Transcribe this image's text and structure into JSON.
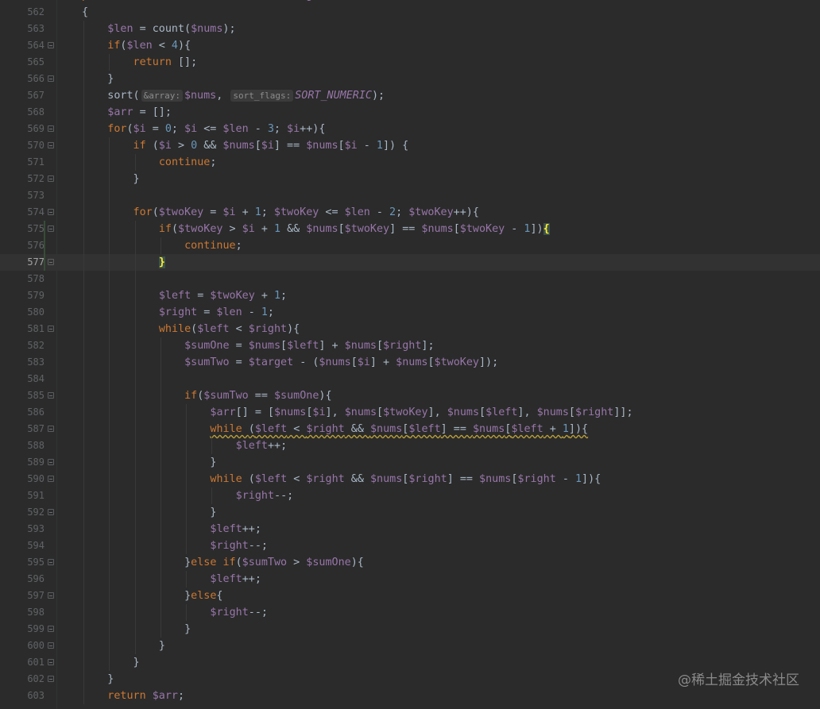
{
  "editor": {
    "lines": [
      {
        "n": "561",
        "indent": 1,
        "tokens": [
          [
            "kw",
            "public "
          ],
          [
            "kw",
            "function "
          ],
          [
            "p",
            "fourSum("
          ],
          [
            "var",
            "$nums"
          ],
          [
            "p",
            ", "
          ],
          [
            "var",
            "$target"
          ],
          [
            "p",
            ")"
          ]
        ]
      },
      {
        "n": "562",
        "indent": 1,
        "tokens": [
          [
            "p",
            "{"
          ]
        ]
      },
      {
        "n": "563",
        "indent": 2,
        "tokens": [
          [
            "var",
            "$len"
          ],
          [
            "p",
            " = count("
          ],
          [
            "var",
            "$nums"
          ],
          [
            "p",
            ");"
          ]
        ]
      },
      {
        "n": "564",
        "indent": 2,
        "fold": true,
        "tokens": [
          [
            "kw",
            "if"
          ],
          [
            "p",
            "("
          ],
          [
            "var",
            "$len"
          ],
          [
            "p",
            " < "
          ],
          [
            "num",
            "4"
          ],
          [
            "p",
            "){"
          ]
        ]
      },
      {
        "n": "565",
        "indent": 3,
        "tokens": [
          [
            "kw",
            "return "
          ],
          [
            "p",
            "[];"
          ]
        ]
      },
      {
        "n": "566",
        "indent": 2,
        "fold": true,
        "tokens": [
          [
            "p",
            "}"
          ]
        ]
      },
      {
        "n": "567",
        "indent": 2,
        "tokens": [
          [
            "p",
            "sort("
          ],
          [
            "hint",
            "&array:"
          ],
          [
            "var",
            "$nums"
          ],
          [
            "p",
            ", "
          ],
          [
            "hint",
            "sort_flags:"
          ],
          [
            "const",
            "SORT_NUMERIC"
          ],
          [
            "p",
            ");"
          ]
        ]
      },
      {
        "n": "568",
        "indent": 2,
        "tokens": [
          [
            "var",
            "$arr"
          ],
          [
            "p",
            " = [];"
          ]
        ]
      },
      {
        "n": "569",
        "indent": 2,
        "fold": true,
        "tokens": [
          [
            "kw",
            "for"
          ],
          [
            "p",
            "("
          ],
          [
            "var",
            "$i"
          ],
          [
            "p",
            " = "
          ],
          [
            "num",
            "0"
          ],
          [
            "p",
            "; "
          ],
          [
            "var",
            "$i"
          ],
          [
            "p",
            " <= "
          ],
          [
            "var",
            "$len"
          ],
          [
            "p",
            " - "
          ],
          [
            "num",
            "3"
          ],
          [
            "p",
            "; "
          ],
          [
            "var",
            "$i"
          ],
          [
            "p",
            "++){"
          ]
        ]
      },
      {
        "n": "570",
        "indent": 3,
        "fold": true,
        "tokens": [
          [
            "kw",
            "if "
          ],
          [
            "p",
            "("
          ],
          [
            "var",
            "$i"
          ],
          [
            "p",
            " > "
          ],
          [
            "num",
            "0"
          ],
          [
            "p",
            " && "
          ],
          [
            "var",
            "$nums"
          ],
          [
            "p",
            "["
          ],
          [
            "var",
            "$i"
          ],
          [
            "p",
            "] == "
          ],
          [
            "var",
            "$nums"
          ],
          [
            "p",
            "["
          ],
          [
            "var",
            "$i"
          ],
          [
            "p",
            " - "
          ],
          [
            "num",
            "1"
          ],
          [
            "p",
            "]) {"
          ]
        ]
      },
      {
        "n": "571",
        "indent": 4,
        "tokens": [
          [
            "kw",
            "continue"
          ],
          [
            "p",
            ";"
          ]
        ]
      },
      {
        "n": "572",
        "indent": 3,
        "fold": true,
        "tokens": [
          [
            "p",
            "}"
          ]
        ]
      },
      {
        "n": "573",
        "indent": 3,
        "tokens": []
      },
      {
        "n": "574",
        "indent": 3,
        "fold": true,
        "tokens": [
          [
            "kw",
            "for"
          ],
          [
            "p",
            "("
          ],
          [
            "var",
            "$twoKey"
          ],
          [
            "p",
            " = "
          ],
          [
            "var",
            "$i"
          ],
          [
            "p",
            " + "
          ],
          [
            "num",
            "1"
          ],
          [
            "p",
            "; "
          ],
          [
            "var",
            "$twoKey"
          ],
          [
            "p",
            " <= "
          ],
          [
            "var",
            "$len"
          ],
          [
            "p",
            " - "
          ],
          [
            "num",
            "2"
          ],
          [
            "p",
            "; "
          ],
          [
            "var",
            "$twoKey"
          ],
          [
            "p",
            "++){"
          ]
        ]
      },
      {
        "n": "575",
        "indent": 4,
        "fold": true,
        "tokens": [
          [
            "kw",
            "if"
          ],
          [
            "p",
            "("
          ],
          [
            "var",
            "$twoKey"
          ],
          [
            "p",
            " > "
          ],
          [
            "var",
            "$i"
          ],
          [
            "p",
            " + "
          ],
          [
            "num",
            "1"
          ],
          [
            "p",
            " && "
          ],
          [
            "var",
            "$nums"
          ],
          [
            "p",
            "["
          ],
          [
            "var",
            "$twoKey"
          ],
          [
            "p",
            "] == "
          ],
          [
            "var",
            "$nums"
          ],
          [
            "p",
            "["
          ],
          [
            "var",
            "$twoKey"
          ],
          [
            "p",
            " - "
          ],
          [
            "num",
            "1"
          ],
          [
            "p",
            "])"
          ],
          [
            "hl",
            "{"
          ]
        ]
      },
      {
        "n": "576",
        "indent": 5,
        "tokens": [
          [
            "kw",
            "continue"
          ],
          [
            "p",
            ";"
          ]
        ]
      },
      {
        "n": "577",
        "indent": 4,
        "fold": true,
        "current": true,
        "tokens": [
          [
            "hl",
            "}"
          ]
        ]
      },
      {
        "n": "578",
        "indent": 4,
        "tokens": []
      },
      {
        "n": "579",
        "indent": 4,
        "tokens": [
          [
            "var",
            "$left"
          ],
          [
            "p",
            " = "
          ],
          [
            "var",
            "$twoKey"
          ],
          [
            "p",
            " + "
          ],
          [
            "num",
            "1"
          ],
          [
            "p",
            ";"
          ]
        ]
      },
      {
        "n": "580",
        "indent": 4,
        "tokens": [
          [
            "var",
            "$right"
          ],
          [
            "p",
            " = "
          ],
          [
            "var",
            "$len"
          ],
          [
            "p",
            " - "
          ],
          [
            "num",
            "1"
          ],
          [
            "p",
            ";"
          ]
        ]
      },
      {
        "n": "581",
        "indent": 4,
        "fold": true,
        "tokens": [
          [
            "kw",
            "while"
          ],
          [
            "p",
            "("
          ],
          [
            "var",
            "$left"
          ],
          [
            "p",
            " < "
          ],
          [
            "var",
            "$right"
          ],
          [
            "p",
            "){"
          ]
        ]
      },
      {
        "n": "582",
        "indent": 5,
        "tokens": [
          [
            "var",
            "$sumOne"
          ],
          [
            "p",
            " = "
          ],
          [
            "var",
            "$nums"
          ],
          [
            "p",
            "["
          ],
          [
            "var",
            "$left"
          ],
          [
            "p",
            "] + "
          ],
          [
            "var",
            "$nums"
          ],
          [
            "p",
            "["
          ],
          [
            "var",
            "$right"
          ],
          [
            "p",
            "];"
          ]
        ]
      },
      {
        "n": "583",
        "indent": 5,
        "tokens": [
          [
            "var",
            "$sumTwo"
          ],
          [
            "p",
            " = "
          ],
          [
            "var",
            "$target"
          ],
          [
            "p",
            " - ("
          ],
          [
            "var",
            "$nums"
          ],
          [
            "p",
            "["
          ],
          [
            "var",
            "$i"
          ],
          [
            "p",
            "] + "
          ],
          [
            "var",
            "$nums"
          ],
          [
            "p",
            "["
          ],
          [
            "var",
            "$twoKey"
          ],
          [
            "p",
            "]);"
          ]
        ]
      },
      {
        "n": "584",
        "indent": 5,
        "tokens": []
      },
      {
        "n": "585",
        "indent": 5,
        "fold": true,
        "tokens": [
          [
            "kw",
            "if"
          ],
          [
            "p",
            "("
          ],
          [
            "var",
            "$sumTwo"
          ],
          [
            "p",
            " == "
          ],
          [
            "var",
            "$sumOne"
          ],
          [
            "p",
            "){"
          ]
        ]
      },
      {
        "n": "586",
        "indent": 6,
        "tokens": [
          [
            "var",
            "$arr"
          ],
          [
            "p",
            "[] = ["
          ],
          [
            "var",
            "$nums"
          ],
          [
            "p",
            "["
          ],
          [
            "var",
            "$i"
          ],
          [
            "p",
            "], "
          ],
          [
            "var",
            "$nums"
          ],
          [
            "p",
            "["
          ],
          [
            "var",
            "$twoKey"
          ],
          [
            "p",
            "], "
          ],
          [
            "var",
            "$nums"
          ],
          [
            "p",
            "["
          ],
          [
            "var",
            "$left"
          ],
          [
            "p",
            "], "
          ],
          [
            "var",
            "$nums"
          ],
          [
            "p",
            "["
          ],
          [
            "var",
            "$right"
          ],
          [
            "p",
            "]];"
          ]
        ]
      },
      {
        "n": "587",
        "indent": 6,
        "fold": true,
        "squig": true,
        "tokens": [
          [
            "kw",
            "while "
          ],
          [
            "p",
            "("
          ],
          [
            "var",
            "$left"
          ],
          [
            "p",
            " < "
          ],
          [
            "var",
            "$right"
          ],
          [
            "p",
            " && "
          ],
          [
            "var",
            "$nums"
          ],
          [
            "p",
            "["
          ],
          [
            "var",
            "$left"
          ],
          [
            "p",
            "] == "
          ],
          [
            "var",
            "$nums"
          ],
          [
            "p",
            "["
          ],
          [
            "var",
            "$left"
          ],
          [
            "p",
            " + "
          ],
          [
            "num",
            "1"
          ],
          [
            "p",
            "]){"
          ]
        ]
      },
      {
        "n": "588",
        "indent": 7,
        "tokens": [
          [
            "var",
            "$left"
          ],
          [
            "p",
            "++;"
          ]
        ]
      },
      {
        "n": "589",
        "indent": 6,
        "fold": true,
        "tokens": [
          [
            "p",
            "}"
          ]
        ]
      },
      {
        "n": "590",
        "indent": 6,
        "fold": true,
        "tokens": [
          [
            "kw",
            "while "
          ],
          [
            "p",
            "("
          ],
          [
            "var",
            "$left"
          ],
          [
            "p",
            " < "
          ],
          [
            "var",
            "$right"
          ],
          [
            "p",
            " && "
          ],
          [
            "var",
            "$nums"
          ],
          [
            "p",
            "["
          ],
          [
            "var",
            "$right"
          ],
          [
            "p",
            "] == "
          ],
          [
            "var",
            "$nums"
          ],
          [
            "p",
            "["
          ],
          [
            "var",
            "$right"
          ],
          [
            "p",
            " - "
          ],
          [
            "num",
            "1"
          ],
          [
            "p",
            "]){"
          ]
        ]
      },
      {
        "n": "591",
        "indent": 7,
        "tokens": [
          [
            "var",
            "$right"
          ],
          [
            "p",
            "--;"
          ]
        ]
      },
      {
        "n": "592",
        "indent": 6,
        "fold": true,
        "tokens": [
          [
            "p",
            "}"
          ]
        ]
      },
      {
        "n": "593",
        "indent": 6,
        "tokens": [
          [
            "var",
            "$left"
          ],
          [
            "p",
            "++;"
          ]
        ]
      },
      {
        "n": "594",
        "indent": 6,
        "tokens": [
          [
            "var",
            "$right"
          ],
          [
            "p",
            "--;"
          ]
        ]
      },
      {
        "n": "595",
        "indent": 5,
        "fold": true,
        "tokens": [
          [
            "p",
            "}"
          ],
          [
            "kw",
            "else if"
          ],
          [
            "p",
            "("
          ],
          [
            "var",
            "$sumTwo"
          ],
          [
            "p",
            " > "
          ],
          [
            "var",
            "$sumOne"
          ],
          [
            "p",
            "){"
          ]
        ]
      },
      {
        "n": "596",
        "indent": 6,
        "tokens": [
          [
            "var",
            "$left"
          ],
          [
            "p",
            "++;"
          ]
        ]
      },
      {
        "n": "597",
        "indent": 5,
        "fold": true,
        "tokens": [
          [
            "p",
            "}"
          ],
          [
            "kw",
            "else"
          ],
          [
            "p",
            "{"
          ]
        ]
      },
      {
        "n": "598",
        "indent": 6,
        "tokens": [
          [
            "var",
            "$right"
          ],
          [
            "p",
            "--;"
          ]
        ]
      },
      {
        "n": "599",
        "indent": 5,
        "fold": true,
        "tokens": [
          [
            "p",
            "}"
          ]
        ]
      },
      {
        "n": "600",
        "indent": 4,
        "fold": true,
        "tokens": [
          [
            "p",
            "}"
          ]
        ]
      },
      {
        "n": "601",
        "indent": 3,
        "fold": true,
        "tokens": [
          [
            "p",
            "}"
          ]
        ]
      },
      {
        "n": "602",
        "indent": 2,
        "fold": true,
        "tokens": [
          [
            "p",
            "}"
          ]
        ]
      },
      {
        "n": "603",
        "indent": 2,
        "tokens": [
          [
            "kw",
            "return "
          ],
          [
            "var",
            "$arr"
          ],
          [
            "p",
            ";"
          ]
        ]
      }
    ]
  },
  "watermark": "@稀土掘金技术社区"
}
